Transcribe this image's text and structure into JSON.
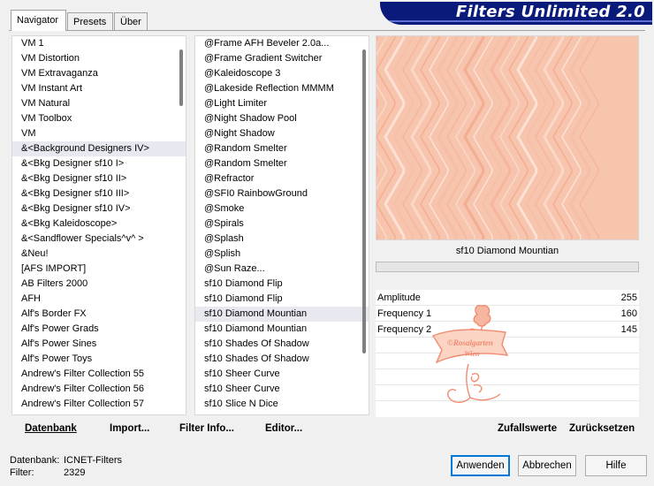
{
  "tabs": [
    {
      "label": "Navigator",
      "active": true
    },
    {
      "label": "Presets",
      "active": false
    },
    {
      "label": "Über",
      "active": false
    }
  ],
  "banner": {
    "title": "Filters Unlimited 2.0",
    "color": "#0a1a7a"
  },
  "categories": [
    "VM 1",
    "VM Distortion",
    "VM Extravaganza",
    "VM Instant Art",
    "VM Natural",
    "VM Toolbox",
    "VM",
    "&<Background Designers IV>",
    "&<Bkg Designer sf10 I>",
    "&<Bkg Designer sf10 II>",
    "&<Bkg Designer sf10 III>",
    "&<Bkg Designer sf10 IV>",
    "&<Bkg Kaleidoscope>",
    "&<Sandflower Specials^v^ >",
    "&Neu!",
    "[AFS IMPORT]",
    "AB Filters 2000",
    "AFH",
    "Alf's Border FX",
    "Alf's Power Grads",
    "Alf's Power Sines",
    "Alf's Power Toys",
    "Andrew's Filter Collection 55",
    "Andrew's Filter Collection 56",
    "Andrew's Filter Collection 57"
  ],
  "categories_selected_index": 7,
  "filters": [
    "@Frame AFH Beveler 2.0a...",
    "@Frame Gradient Switcher",
    "@Kaleidoscope 3",
    "@Lakeside Reflection MMMM",
    "@Light Limiter",
    "@Night Shadow Pool",
    "@Night Shadow",
    "@Random Smelter",
    "@Random Smelter",
    "@Refractor",
    "@SFI0 RainbowGround",
    "@Smoke",
    "@Spirals",
    "@Splash",
    "@Splish",
    "@Sun Raze...",
    "sf10 Diamond Flip",
    "sf10 Diamond Flip",
    "sf10 Diamond Mountian",
    "sf10 Diamond Mountian",
    "sf10 Shades Of Shadow",
    "sf10 Shades Of Shadow",
    "sf10 Sheer Curve",
    "sf10 Sheer Curve",
    "sf10 Slice N Dice"
  ],
  "filters_selected_index": 18,
  "preview": {
    "filter_name": "sf10 Diamond Mountian",
    "base_color": "#f7c4ad"
  },
  "params": [
    {
      "label": "Amplitude",
      "value": "255"
    },
    {
      "label": "Frequency 1",
      "value": "160"
    },
    {
      "label": "Frequency 2",
      "value": "145"
    }
  ],
  "watermark": {
    "line1": "©Rosalgarten",
    "line2": "Wien",
    "color": "#f08b70"
  },
  "toolbar": {
    "datenbank": "Datenbank",
    "import": "Import...",
    "filterinfo": "Filter Info...",
    "editor": "Editor...",
    "zufall": "Zufallswerte",
    "reset": "Zurücksetzen"
  },
  "status": {
    "db_label": "Datenbank:",
    "db_value": "ICNET-Filters",
    "filter_label": "Filter:",
    "filter_value": "2329"
  },
  "buttons": {
    "apply": "Anwenden",
    "cancel": "Abbrechen",
    "help": "Hilfe"
  }
}
